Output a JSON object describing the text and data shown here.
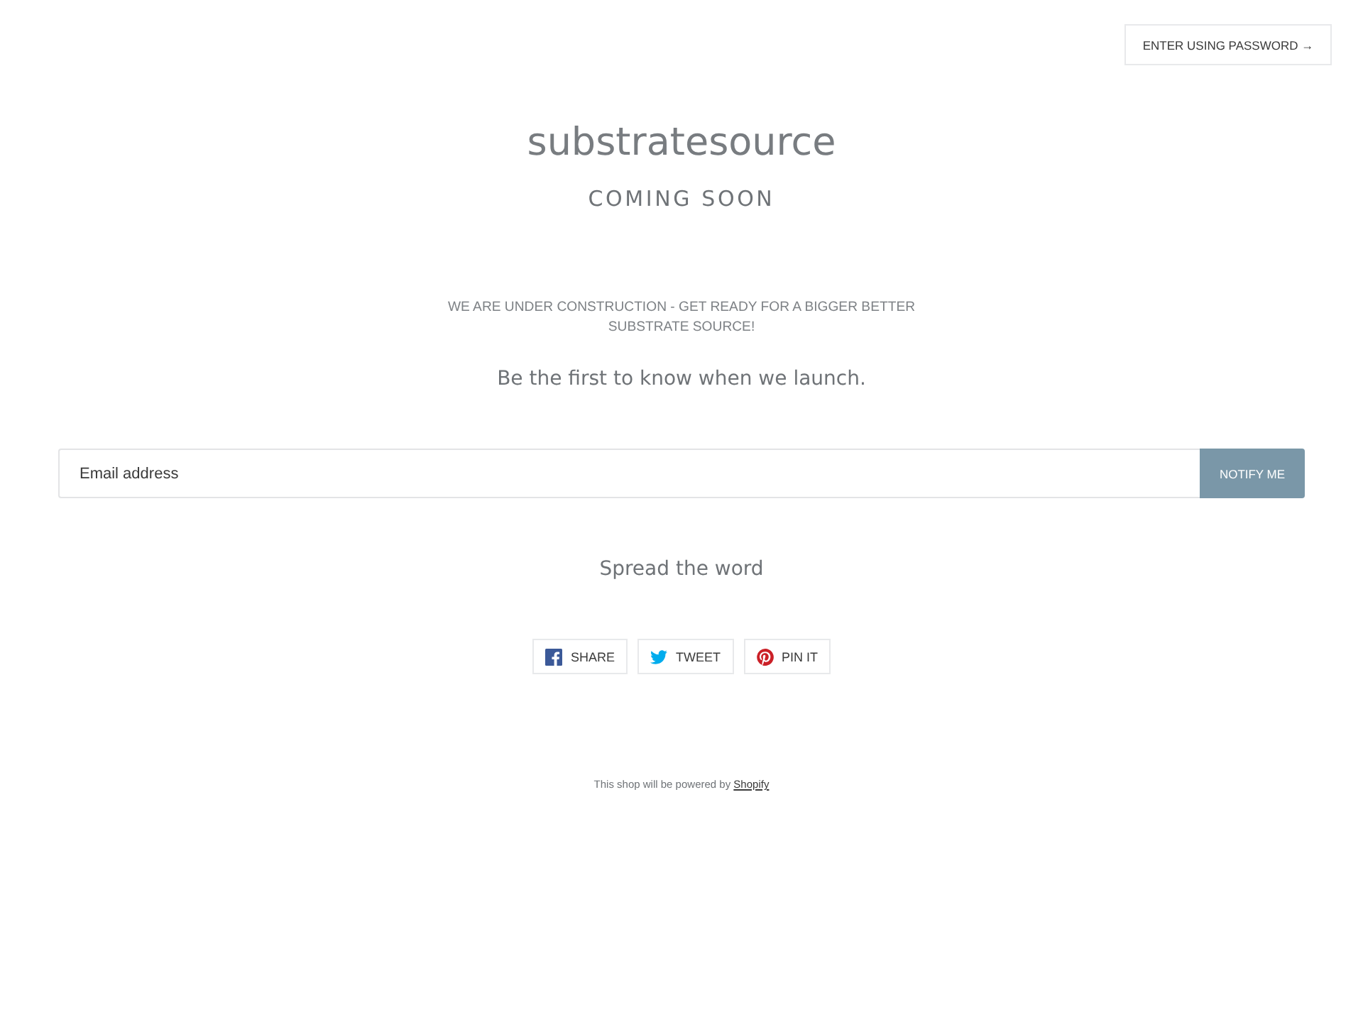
{
  "header": {
    "password_button": "ENTER USING PASSWORD →"
  },
  "hero": {
    "title": "substratesource",
    "subtitle": "COMING SOON"
  },
  "message": "WE ARE UNDER CONSTRUCTION - GET READY FOR A BIGGER BETTER SUBSTRATE SOURCE!",
  "signup": {
    "heading": "Be the first to know when we launch.",
    "email_field": {
      "placeholder": "Email address"
    },
    "submit_button": "NOTIFY ME"
  },
  "share": {
    "heading": "Spread the word",
    "buttons": [
      {
        "kind": "facebook",
        "label": "SHARE"
      },
      {
        "kind": "twitter",
        "label": "TWEET"
      },
      {
        "kind": "pinterest",
        "label": "PIN IT"
      }
    ]
  },
  "footer": {
    "text": "This shop will be powered by",
    "link": "Shopify"
  }
}
